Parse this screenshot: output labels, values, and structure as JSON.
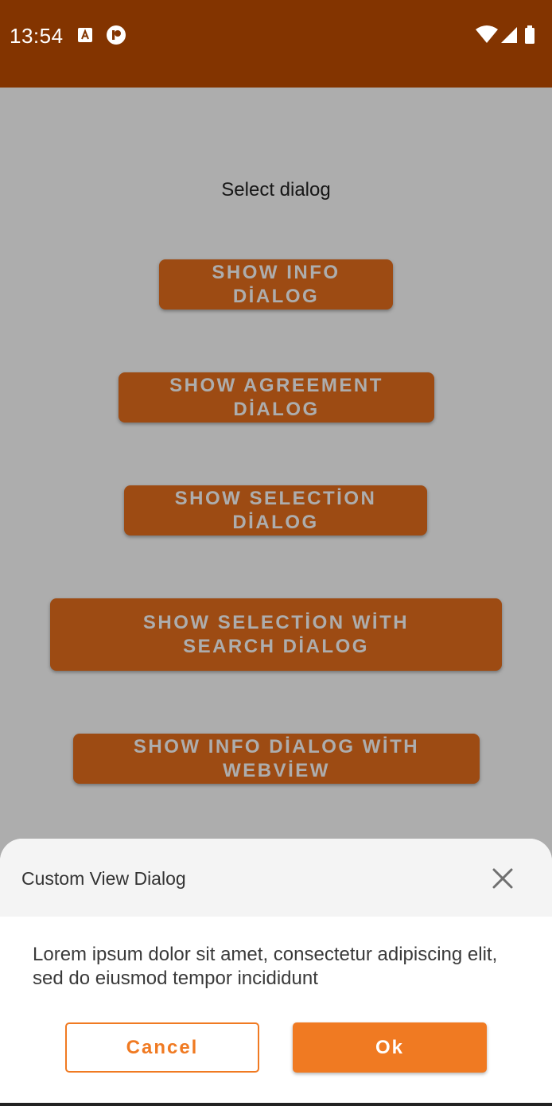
{
  "status_bar": {
    "time": "13:54",
    "icons": [
      "a-app-icon",
      "p-app-icon",
      "wifi-icon",
      "signal-icon",
      "battery-icon"
    ],
    "color": "#833400"
  },
  "main": {
    "title": "Select dialog",
    "buttons": [
      {
        "label": "SHOW INFO DİALOG"
      },
      {
        "label": "SHOW AGREEMENT DİALOG"
      },
      {
        "label": "SHOW SELECTİON DİALOG"
      },
      {
        "label": "SHOW SELECTİON WİTH SEARCH DİALOG"
      },
      {
        "label": "SHOW INFO DİALOG WİTH WEBVİEW"
      }
    ],
    "button_color": "#e86f1c"
  },
  "dialog": {
    "title": "Custom View Dialog",
    "close_icon": "close-icon",
    "message": "Lorem ipsum dolor sit amet, consectetur adipiscing elit, sed do eiusmod tempor incididunt",
    "cancel_label": "Cancel",
    "ok_label": "Ok",
    "accent_color": "#f07a22"
  }
}
